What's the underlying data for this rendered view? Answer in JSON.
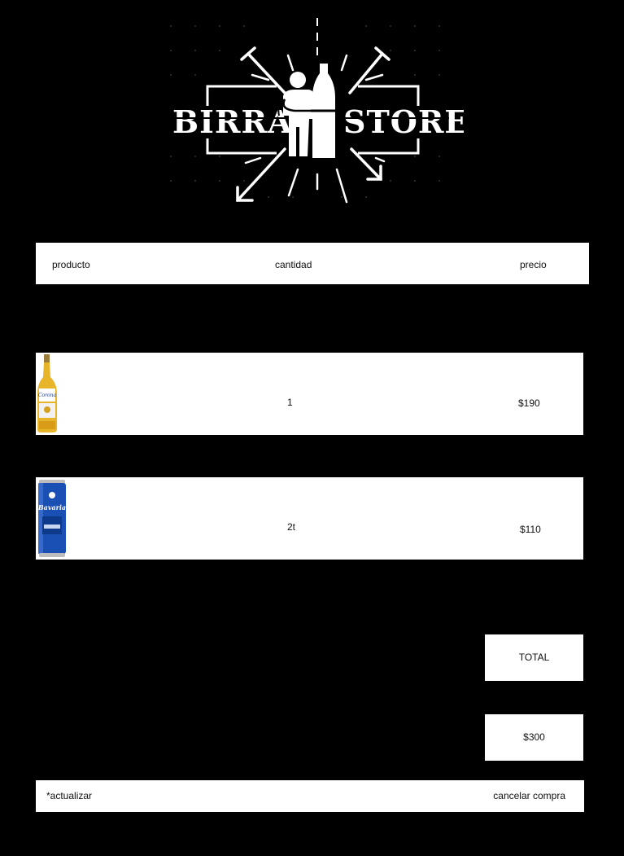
{
  "brand": {
    "word_left": "BIRRA",
    "word_right": "STORE"
  },
  "cart_header": {
    "product": "producto",
    "quantity": "cantidad",
    "price": "precio"
  },
  "items": [
    {
      "image_icon": "corona-beer-bottle",
      "quantity": "1",
      "price": "$190"
    },
    {
      "image_icon": "bavaria-beer-can",
      "quantity": "2t",
      "price": "$110"
    }
  ],
  "summary": {
    "total_label": "TOTAL",
    "total_value": "$300"
  },
  "footer": {
    "update_label": "*actualizar",
    "cancel_label": "cancelar compra"
  },
  "colors": {
    "background": "#000000",
    "panel": "#ffffff",
    "text": "#111111",
    "corona_label": "#e8b52a",
    "bavaria_blue": "#1a4fb3"
  }
}
